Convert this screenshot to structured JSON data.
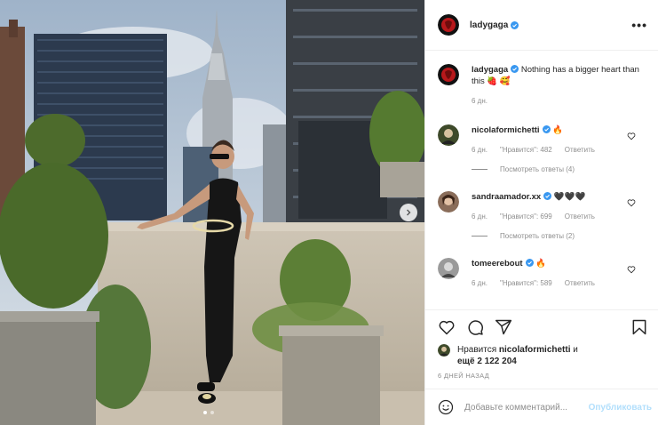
{
  "post": {
    "author": "ladygaga",
    "verified": true,
    "more_label": "•••",
    "carousel": {
      "current": 1,
      "total": 2
    }
  },
  "caption": {
    "username": "ladygaga",
    "text": "Nothing has a bigger heart than this 🍓 🥰",
    "age": "6 дн."
  },
  "comments": [
    {
      "username": "nicolaformichetti",
      "text": "🔥",
      "age": "6 дн.",
      "likes": "\"Нравится\": 482",
      "reply": "Ответить",
      "view_replies": "Посмотреть ответы (4)"
    },
    {
      "username": "sandraamador.xx",
      "text": "🖤🖤🖤",
      "age": "6 дн.",
      "likes": "\"Нравится\": 699",
      "reply": "Ответить",
      "view_replies": "Посмотреть ответы (2)"
    },
    {
      "username": "tomeerebout",
      "text": "🔥",
      "age": "6 дн.",
      "likes": "\"Нравится\": 589",
      "reply": "Ответить"
    }
  ],
  "likes": {
    "prefix": "Нравится",
    "name": "nicolaformichetti",
    "suffix": "и",
    "others": "ещё 2 122 204"
  },
  "timestamp": "6 ДНЕЙ НАЗАД",
  "comment_box": {
    "placeholder": "Добавьте комментарий...",
    "publish_label": "Опубликовать"
  },
  "colors": {
    "verified": "#3897f0",
    "publish_disabled": "#b2dffc",
    "muted": "#8e8e8e",
    "text": "#262626"
  },
  "icons": [
    "heart-icon",
    "comment-icon",
    "share-icon",
    "bookmark-icon",
    "emoji-icon",
    "more-icon",
    "chevron-right-icon",
    "verified-icon"
  ]
}
